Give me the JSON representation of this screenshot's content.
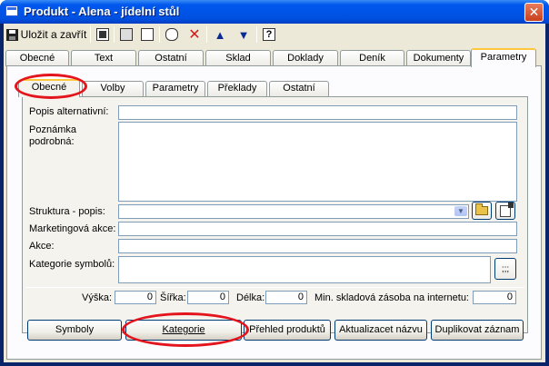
{
  "window": {
    "title": "Produkt - Alena - jídelní stůl",
    "close_glyph": "✕"
  },
  "toolbar": {
    "save_label": "Uložit a zavřít",
    "icons": [
      "save-icon",
      "copy-icon",
      "print-icon",
      "print-preview-icon",
      "attach-icon",
      "delete-icon",
      "arrow-up-icon",
      "arrow-down-icon",
      "help-icon"
    ],
    "delete_glyph": "✕",
    "up_glyph": "▲",
    "down_glyph": "▼",
    "help_glyph": "?"
  },
  "main_tabs": [
    "Obecné",
    "Text",
    "Ostatní",
    "Sklad",
    "Doklady",
    "Deník",
    "Dokumenty",
    "Parametry"
  ],
  "main_tabs_active": "Parametry",
  "sub_tabs": [
    "Obecné",
    "Volby",
    "Parametry",
    "Překlady",
    "Ostatní"
  ],
  "sub_tabs_active": "Obecné",
  "form": {
    "popis_alternativni": {
      "label": "Popis alternativní:",
      "value": ""
    },
    "poznamka": {
      "label_line1": "Poznámka",
      "label_line2": "podrobná:",
      "value": ""
    },
    "struktura": {
      "label": "Struktura - popis:",
      "value": "",
      "arrow": "▼"
    },
    "marketingova_akce": {
      "label": "Marketingová akce:",
      "value": ""
    },
    "akce": {
      "label": "Akce:",
      "value": ""
    },
    "kategorie_symbolu": {
      "label": "Kategorie symbolů:",
      "value": "",
      "button": ";;;"
    }
  },
  "dimensions": {
    "vyska": {
      "label": "Výška:",
      "value": "0"
    },
    "sirka": {
      "label": "Šířka:",
      "value": "0"
    },
    "delka": {
      "label": "Délka:",
      "value": "0"
    },
    "min_zasoba": {
      "label": "Min. skladová zásoba na internetu:",
      "value": "0"
    }
  },
  "buttons": {
    "symboly": "Symboly",
    "kategorie": "Kategorie",
    "prehled": "Přehled produktů",
    "aktualizace": "Aktualizacet názvu",
    "duplikovat": "Duplikovat záznam"
  },
  "colors": {
    "annotation": "#e4141c",
    "active_tab_accent": "#ffc83c",
    "title_blue": "#0050e0"
  }
}
